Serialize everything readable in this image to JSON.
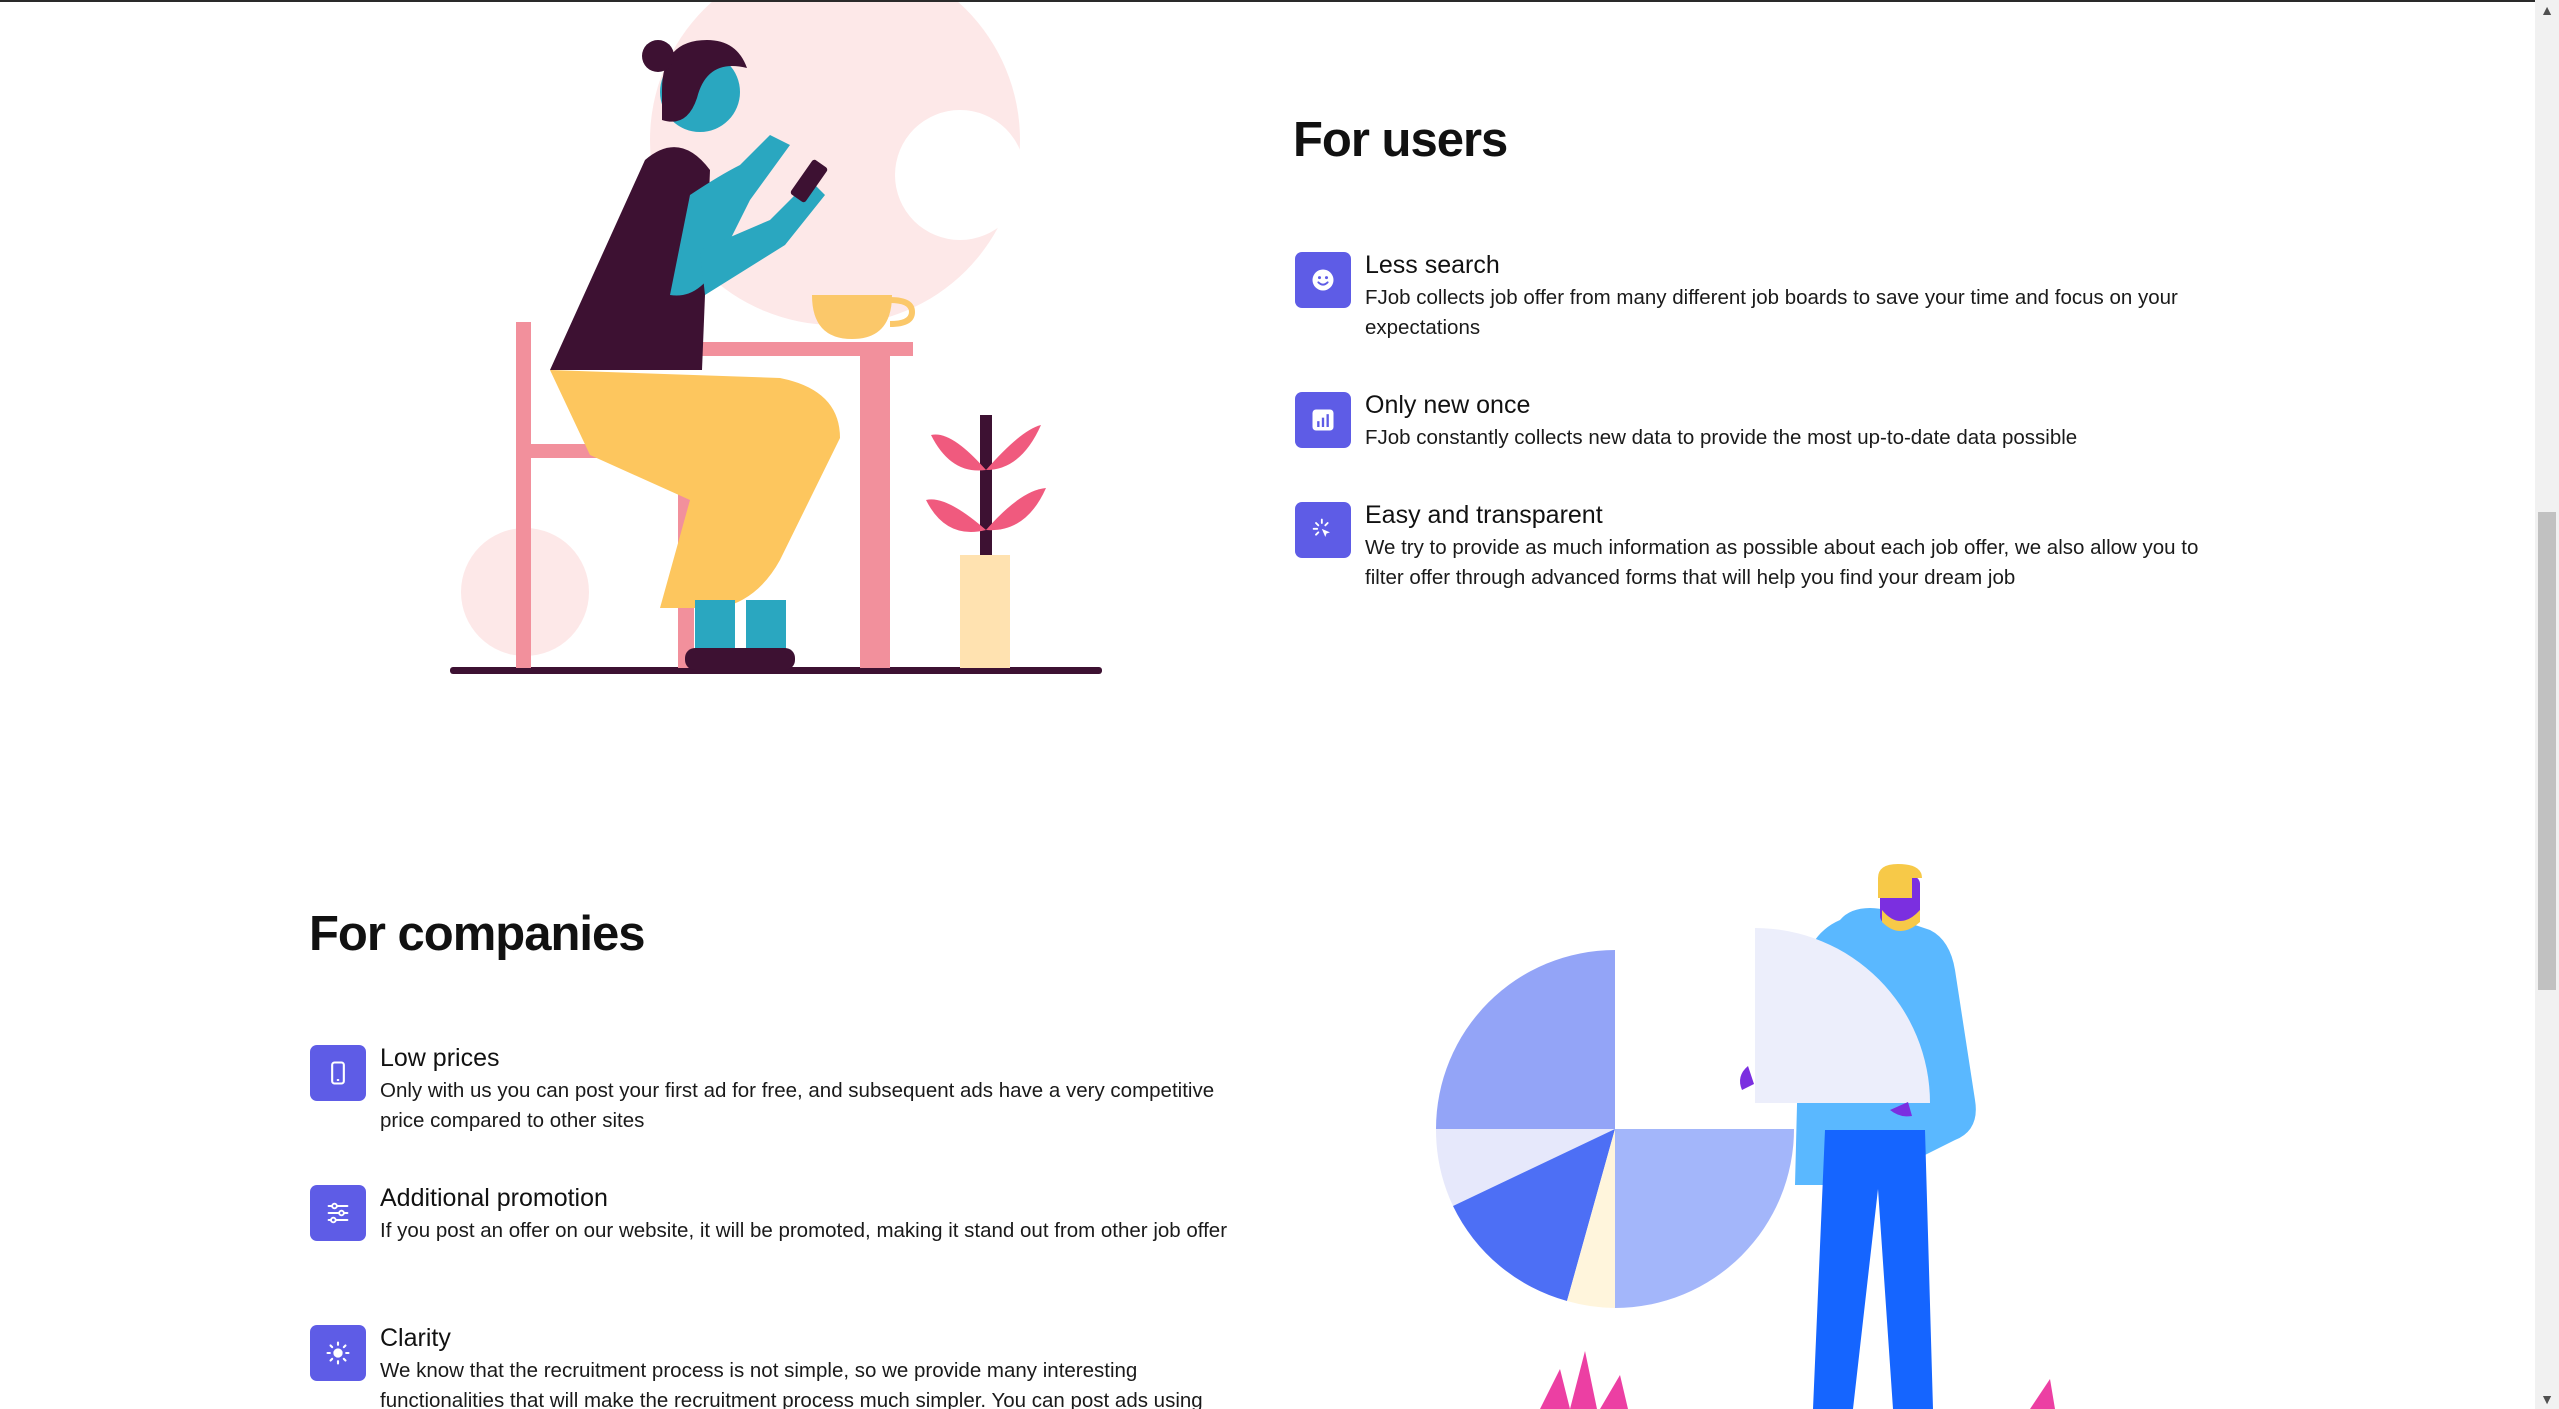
{
  "users": {
    "title": "For users",
    "features": [
      {
        "icon": "smile-icon",
        "title": "Less search",
        "desc": "FJob collects job offer from many different job boards to save your time and focus on your expectations"
      },
      {
        "icon": "chart-icon",
        "title": "Only new once",
        "desc": "FJob constantly collects new data to provide the most up-to-date data possible"
      },
      {
        "icon": "cursor-click-icon",
        "title": "Easy and transparent",
        "desc": "We try to provide as much information as possible about each job offer, we also allow you to filter offer through advanced forms that will help you find your dream job"
      }
    ]
  },
  "companies": {
    "title": "For companies",
    "features": [
      {
        "icon": "phone-icon",
        "title": "Low prices",
        "desc": "Only with us you can post your first ad for free, and subsequent ads have a very competitive price compared to other sites"
      },
      {
        "icon": "sliders-icon",
        "title": "Additional promotion",
        "desc": "If you post an offer on our website, it will be promoted, making it stand out from other job offer"
      },
      {
        "icon": "sun-icon",
        "title": "Clarity",
        "desc": "We know that the recruitment process is not simple, so we provide many interesting functionalities that will make the recruitment process much simpler. You can post ads using"
      }
    ]
  },
  "colors": {
    "accent": "#5e5ce6"
  }
}
